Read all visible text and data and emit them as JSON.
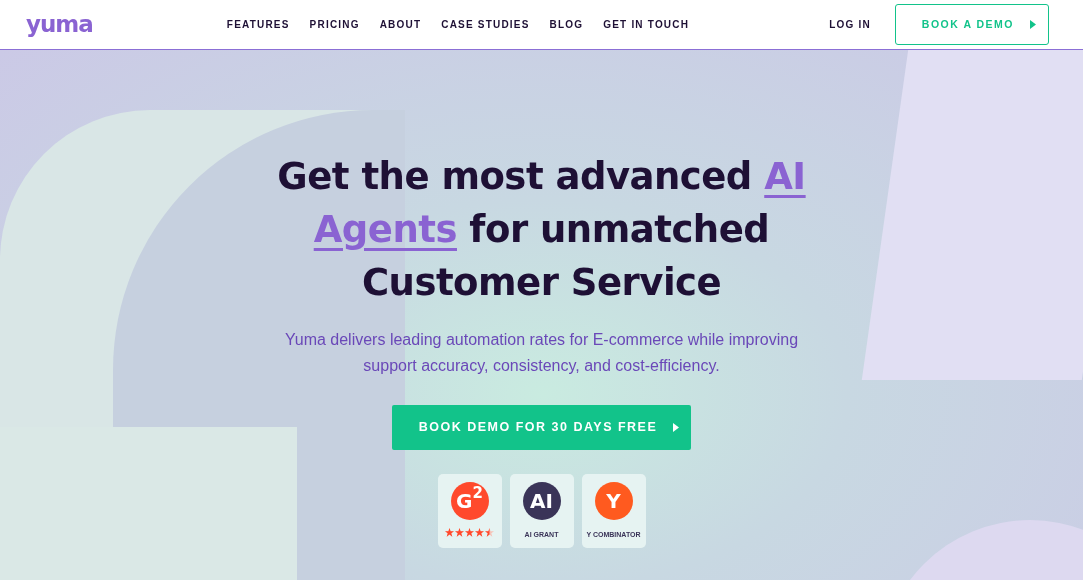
{
  "header": {
    "logo": "yuma",
    "nav": [
      {
        "label": "FEATURES"
      },
      {
        "label": "PRICING"
      },
      {
        "label": "ABOUT"
      },
      {
        "label": "CASE STUDIES"
      },
      {
        "label": "BLOG"
      },
      {
        "label": "GET IN TOUCH"
      }
    ],
    "login": "LOG IN",
    "cta": "BOOK A DEMO"
  },
  "hero": {
    "heading": [
      {
        "text": "Get the most advanced ",
        "highlight": false
      },
      {
        "text": "AI Agents",
        "highlight": true
      },
      {
        "text": " for unmatched Customer Service",
        "highlight": false
      }
    ],
    "subtitle": "Yuma delivers leading automation rates for E-commerce while improving support accuracy, consistency, and cost-efficiency.",
    "cta": "BOOK DEMO FOR 30 DAYS FREE",
    "badges": [
      {
        "kind": "rating",
        "logo": "G$^{2}$",
        "color": "#ff492c",
        "stars": 4.5
      },
      {
        "kind": "label",
        "logo": "AI",
        "color": "#3a3458",
        "caption": "AI GRANT"
      },
      {
        "kind": "label",
        "logo": "Y",
        "color": "#ff5a1f",
        "caption": "Y COMBINATOR"
      }
    ]
  }
}
